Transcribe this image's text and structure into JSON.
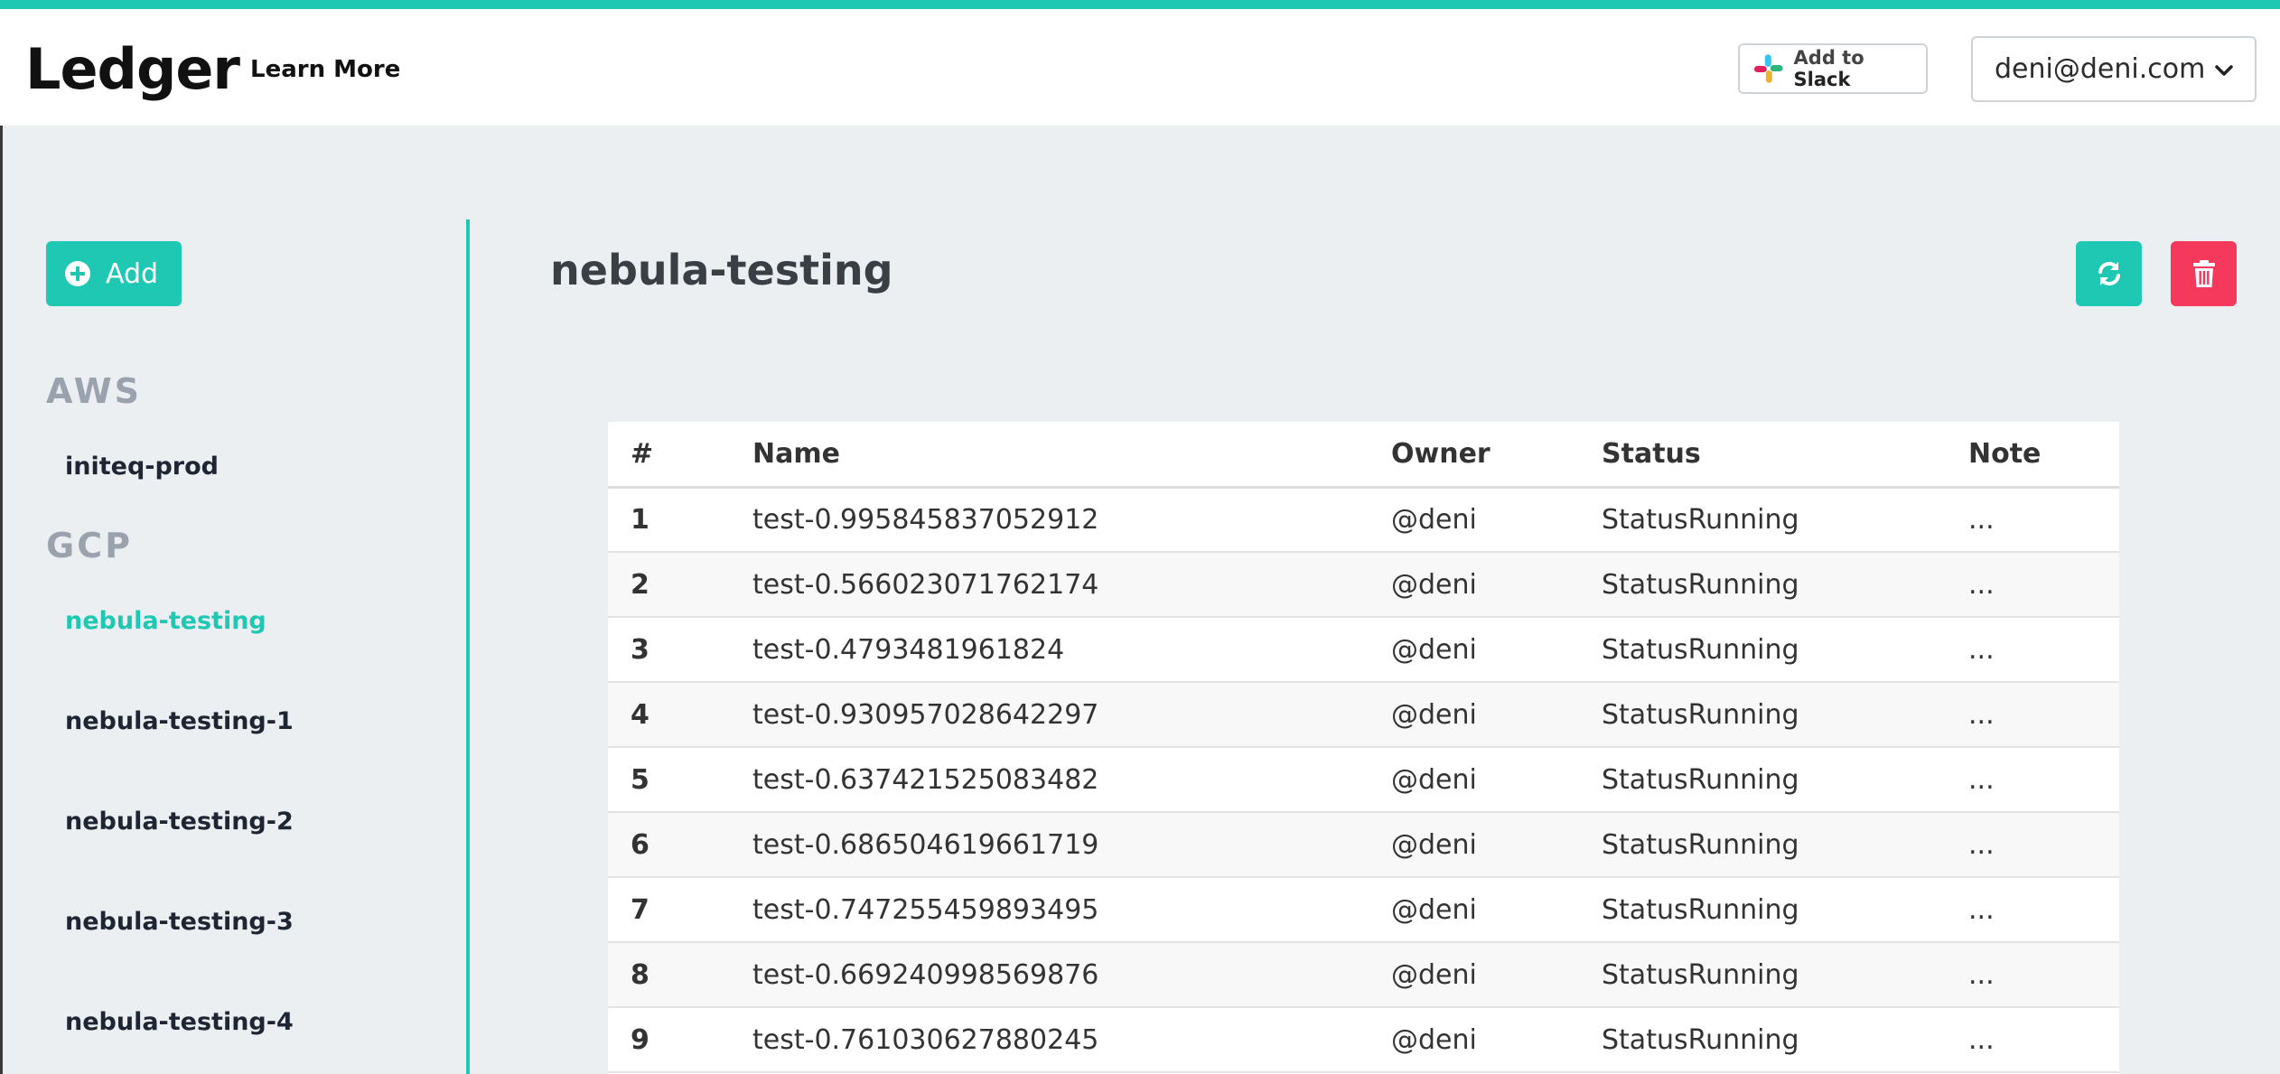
{
  "header": {
    "brand": "Ledger",
    "learn_more": "Learn More",
    "slack_button": {
      "prefix": "Add to ",
      "brand": "Slack"
    },
    "user_email": "deni@deni.com"
  },
  "sidebar": {
    "add_label": "Add",
    "groups": [
      {
        "label": "AWS",
        "items": [
          "initeq-prod"
        ]
      },
      {
        "label": "GCP",
        "items": [
          "nebula-testing",
          "nebula-testing-1",
          "nebula-testing-2",
          "nebula-testing-3",
          "nebula-testing-4"
        ]
      }
    ],
    "active_item": "nebula-testing"
  },
  "main": {
    "title": "nebula-testing",
    "table": {
      "columns": [
        "#",
        "Name",
        "Owner",
        "Status",
        "Note"
      ],
      "rows": [
        [
          "1",
          "test-0.995845837052912",
          "@deni",
          "StatusRunning",
          "..."
        ],
        [
          "2",
          "test-0.566023071762174",
          "@deni",
          "StatusRunning",
          "..."
        ],
        [
          "3",
          "test-0.4793481961824",
          "@deni",
          "StatusRunning",
          "..."
        ],
        [
          "4",
          "test-0.930957028642297",
          "@deni",
          "StatusRunning",
          "..."
        ],
        [
          "5",
          "test-0.637421525083482",
          "@deni",
          "StatusRunning",
          "..."
        ],
        [
          "6",
          "test-0.686504619661719",
          "@deni",
          "StatusRunning",
          "..."
        ],
        [
          "7",
          "test-0.747255459893495",
          "@deni",
          "StatusRunning",
          "..."
        ],
        [
          "8",
          "test-0.669240998569876",
          "@deni",
          "StatusRunning",
          "..."
        ],
        [
          "9",
          "test-0.761030627880245",
          "@deni",
          "StatusRunning",
          "..."
        ]
      ]
    }
  },
  "colors": {
    "accent": "#1fc8b3",
    "danger": "#f5395d",
    "background": "#eceff2",
    "group_label": "#9aa3ad"
  },
  "icons": {
    "add": "plus-circle-icon",
    "refresh": "refresh-icon",
    "delete": "trash-icon",
    "slack": "slack-logo-icon",
    "dropdown": "chevron-down-icon"
  }
}
